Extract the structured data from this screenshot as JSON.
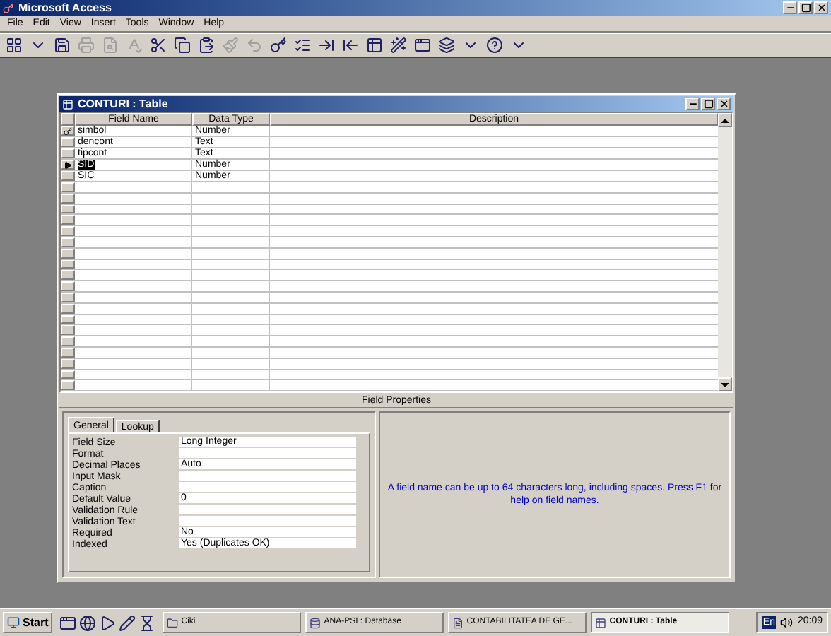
{
  "app_window": {
    "title": "Microsoft Access"
  },
  "menu": [
    "File",
    "Edit",
    "View",
    "Insert",
    "Tools",
    "Window",
    "Help"
  ],
  "table_window": {
    "title": "CONTURI : Table",
    "columns": [
      "Field Name",
      "Data Type",
      "Description"
    ],
    "rows": [
      {
        "field_name": "simbol",
        "data_type": "Number",
        "primary_key": true,
        "selected": false
      },
      {
        "field_name": "dencont",
        "data_type": "Text",
        "primary_key": false,
        "selected": false
      },
      {
        "field_name": "tipcont",
        "data_type": "Text",
        "primary_key": false,
        "selected": false
      },
      {
        "field_name": "SID",
        "data_type": "Number",
        "primary_key": false,
        "selected": true
      },
      {
        "field_name": "SIC",
        "data_type": "Number",
        "primary_key": false,
        "selected": false
      }
    ],
    "field_properties_title": "Field Properties",
    "tabs": [
      {
        "label": "General",
        "selected": true
      },
      {
        "label": "Lookup",
        "selected": false
      }
    ],
    "properties": [
      {
        "label": "Field Size",
        "value": "Long Integer"
      },
      {
        "label": "Format"
      },
      {
        "label": "Decimal Places",
        "value": "Auto"
      },
      {
        "label": "Input Mask"
      },
      {
        "label": "Caption"
      },
      {
        "label": "Default Value",
        "value": "0"
      },
      {
        "label": "Validation Rule"
      },
      {
        "label": "Validation Text"
      },
      {
        "label": "Required",
        "value": "No"
      },
      {
        "label": "Indexed",
        "value": "Yes (Duplicates OK)"
      }
    ],
    "help_text": "A field name can be up to 64 characters long, including spaces.  Press F1 for help on field names."
  },
  "taskbar": {
    "start": "Start",
    "tasks": [
      {
        "label": "Ciki",
        "selected": false
      },
      {
        "label": "ANA-PSI : Database",
        "selected": false
      },
      {
        "label": "CONTABILITATEA DE GE...",
        "selected": false
      },
      {
        "label": "CONTURI : Table",
        "selected": true
      }
    ],
    "language": "En",
    "clock": "20:09"
  }
}
